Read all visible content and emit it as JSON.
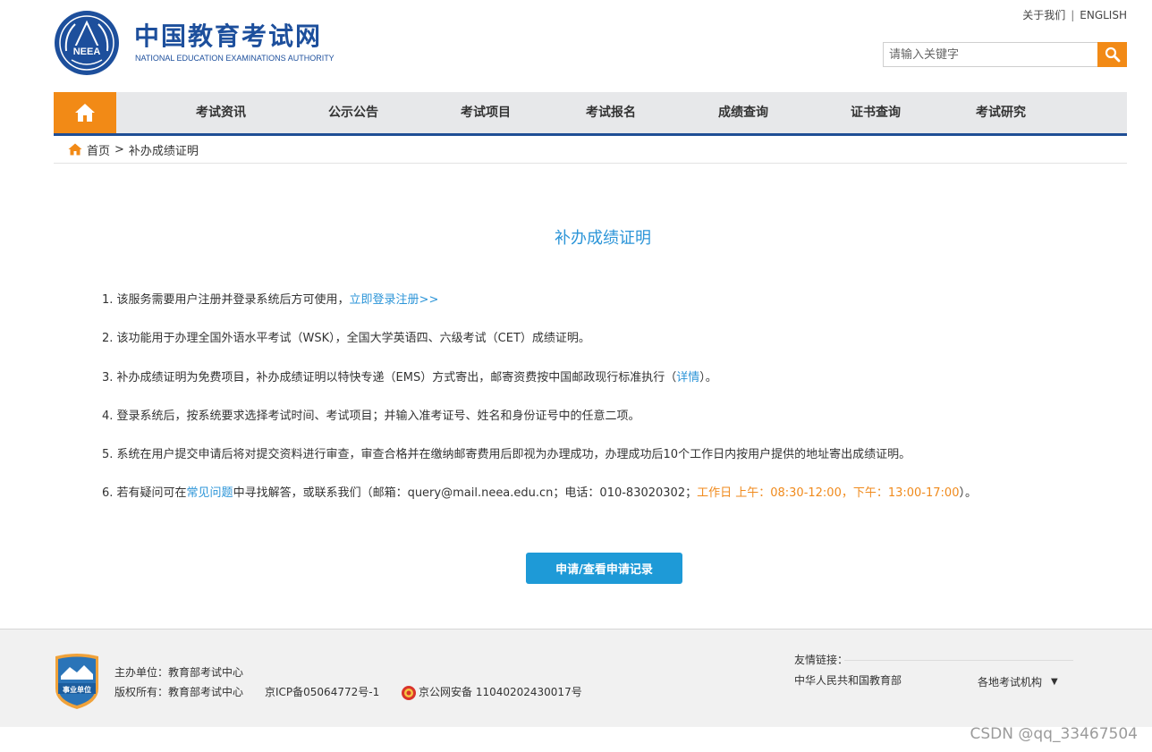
{
  "header": {
    "brand_cn": "中国教育考试网",
    "brand_en": "NATIONAL EDUCATION EXAMINATIONS AUTHORITY",
    "logo_text": "NEEA",
    "about_label": "关于我们",
    "separator": "|",
    "english_label": "ENGLISH",
    "search_placeholder": "请输入关键字"
  },
  "nav": {
    "items": [
      {
        "label": "考试资讯"
      },
      {
        "label": "公示公告"
      },
      {
        "label": "考试项目"
      },
      {
        "label": "考试报名"
      },
      {
        "label": "成绩查询"
      },
      {
        "label": "证书查询"
      },
      {
        "label": "考试研究"
      }
    ]
  },
  "breadcrumb": {
    "home": "首页",
    "sep": ">",
    "current": "补办成绩证明"
  },
  "main": {
    "title": "补办成绩证明",
    "item1": {
      "text": "1. 该服务需要用户注册并登录系统后方可使用，",
      "link": "立即登录注册>>"
    },
    "item2": {
      "text": "2. 该功能用于办理全国外语水平考试（WSK），全国大学英语四、六级考试（CET）成绩证明。"
    },
    "item3": {
      "text": "3. 补办成绩证明为免费项目，补办成绩证明以特快专递（EMS）方式寄出，邮寄资费按中国邮政现行标准执行（",
      "link": "详情",
      "tail": "）。"
    },
    "item4": {
      "text": "4. 登录系统后，按系统要求选择考试时间、考试项目；并输入准考证号、姓名和身份证号中的任意二项。"
    },
    "item5": {
      "text": "5. 系统在用户提交申请后将对提交资料进行审查，审查合格并在缴纳邮寄费用后即视为办理成功，办理成功后10个工作日内按用户提供的地址寄出成绩证明。"
    },
    "item6": {
      "text_a": "6. 若有疑问可在",
      "link": "常见问题",
      "text_b": "中寻找解答，或联系我们（邮箱：query@mail.neea.edu.cn；电话：010-83020302；",
      "hours": "工作日 上午：08:30-12:00，下午：13:00-17:00",
      "tail": "）。"
    },
    "apply_button": "申请/查看申请记录"
  },
  "footer": {
    "badge_text": "事业单位",
    "host": "主办单位：教育部考试中心",
    "copyright": "版权所有：教育部考试中心",
    "icp": "京ICP备05064772号-1",
    "police": "京公网安备 11040202430017号",
    "friend_title": "友情链接：",
    "friend_link": "中华人民共和国教育部",
    "dropdown_label": "各地考试机构",
    "dropdown_caret": "▼"
  },
  "watermark": "CSDN @qq_33467504",
  "colors": {
    "brand_blue": "#1d4f9c",
    "accent_orange": "#f28a16",
    "link_blue": "#2c95d8",
    "button_blue": "#1e9ad7"
  }
}
